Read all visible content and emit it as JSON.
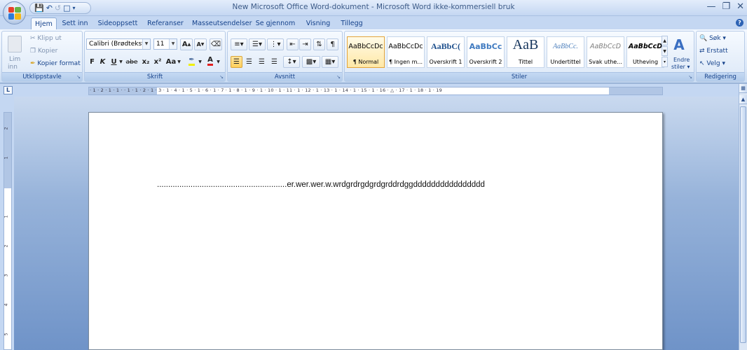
{
  "window": {
    "title": "New Microsoft Office Word-dokument - Microsoft Word ikke-kommersiell bruk"
  },
  "qat": {
    "dropdown": "▾"
  },
  "tabs": [
    {
      "label": "Hjem"
    },
    {
      "label": "Sett inn"
    },
    {
      "label": "Sideoppsett"
    },
    {
      "label": "Referanser"
    },
    {
      "label": "Masseutsendelser"
    },
    {
      "label": "Se gjennom"
    },
    {
      "label": "Visning"
    },
    {
      "label": "Tillegg"
    }
  ],
  "clipboard": {
    "paste": "Lim",
    "paste2": "inn",
    "cut": "Klipp ut",
    "copy": "Kopier",
    "format_painter": "Kopier format",
    "group_label": "Utklippstavle"
  },
  "font": {
    "family": "Calibri (Brødtekst)",
    "size": "11",
    "bold": "F",
    "italic": "K",
    "underline": "U",
    "strike": "abe",
    "subscript": "x₂",
    "superscript": "x²",
    "case": "Aa",
    "color_letter": "A",
    "grow": "A",
    "shrink": "A",
    "group_label": "Skrift"
  },
  "paragraph": {
    "group_label": "Avsnitt",
    "pilcrow": "¶"
  },
  "styles": {
    "items": [
      {
        "sample": "AaBbCcDc",
        "name": "¶ Normal"
      },
      {
        "sample": "AaBbCcDc",
        "name": "¶ Ingen m..."
      },
      {
        "sample": "AaBbC(",
        "name": "Overskrift 1"
      },
      {
        "sample": "AaBbCc",
        "name": "Overskrift 2"
      },
      {
        "sample": "AaB",
        "name": "Tittel"
      },
      {
        "sample": "AaBbCc.",
        "name": "Undertittel"
      },
      {
        "sample": "AaBbCcD",
        "name": "Svak uthe..."
      },
      {
        "sample": "AaBbCcD",
        "name": "Utheving"
      }
    ],
    "change_styles": "Endre",
    "change_styles2": "stiler",
    "group_label": "Stiler"
  },
  "editing": {
    "find": "Søk",
    "replace": "Erstatt",
    "select": "Velg",
    "group_label": "Redigering"
  },
  "ruler": {
    "numbers": "· 1 · 2 · 1 · 1 · · 1 · 1 · 2 · 1 · 3 · 1 · 4 · 1 · 5 · 1 · 6 · 1 · 7 · 1 · 8 · 1 · 9 · 1 · 10 · 1 · 11 · 1 · 12 · 1 · 13 · 1 · 14 · 1 · 15 · 1 · 16 · △ · 17 · 1 · 18 · 1 · 19",
    "corner": "L",
    "vnums": [
      "2",
      "1",
      "1",
      "2",
      "3",
      "4",
      "5"
    ]
  },
  "document": {
    "text": "..........................................................er.wer.wer.w.wrdgrdrgdgrdgrddrdggdddddddddddddddd"
  },
  "colors": {
    "ribbon_bg": "#dde9f8",
    "accent": "#15428b",
    "style_active": "#ffe8a6"
  }
}
